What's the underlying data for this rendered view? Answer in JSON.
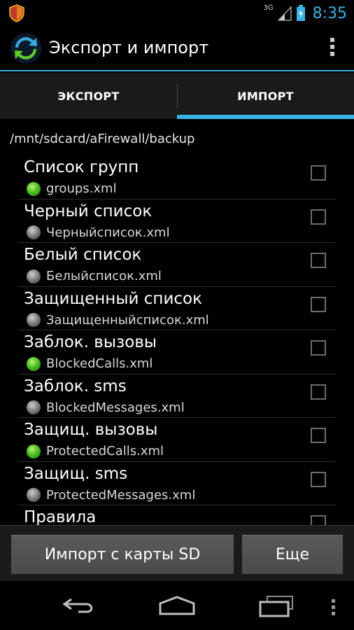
{
  "status_bar": {
    "network": "3G",
    "time": "8:35"
  },
  "action_bar": {
    "title": "Экспорт и импорт"
  },
  "tabs": [
    {
      "label": "ЭКСПОРТ",
      "selected": false
    },
    {
      "label": "ИМПОРТ",
      "selected": true
    }
  ],
  "path": "/mnt/sdcard/aFirewall/backup",
  "items": [
    {
      "title": "Список групп",
      "file": "groups.xml",
      "status": "green"
    },
    {
      "title": "Черный список",
      "file": "Черныйсписок.xml",
      "status": "grey"
    },
    {
      "title": "Белый список",
      "file": "Белыйсписок.xml",
      "status": "grey"
    },
    {
      "title": "Защищенный список",
      "file": "Защищенныйсписок.xml",
      "status": "grey"
    },
    {
      "title": "Заблок. вызовы",
      "file": "BlockedCalls.xml",
      "status": "green"
    },
    {
      "title": "Заблок. sms",
      "file": "BlockedMessages.xml",
      "status": "grey"
    },
    {
      "title": "Защищ. вызовы",
      "file": "ProtectedCalls.xml",
      "status": "green"
    },
    {
      "title": "Защищ. sms",
      "file": "ProtectedMessages.xml",
      "status": "grey"
    },
    {
      "title": "Правила",
      "file": "",
      "status": "none"
    }
  ],
  "buttons": {
    "import_label": "Импорт с карты SD",
    "more_label": "Еще"
  },
  "colors": {
    "accent": "#33b5e5",
    "status_green": "#4cc21a",
    "status_grey": "#7a7a7a"
  }
}
